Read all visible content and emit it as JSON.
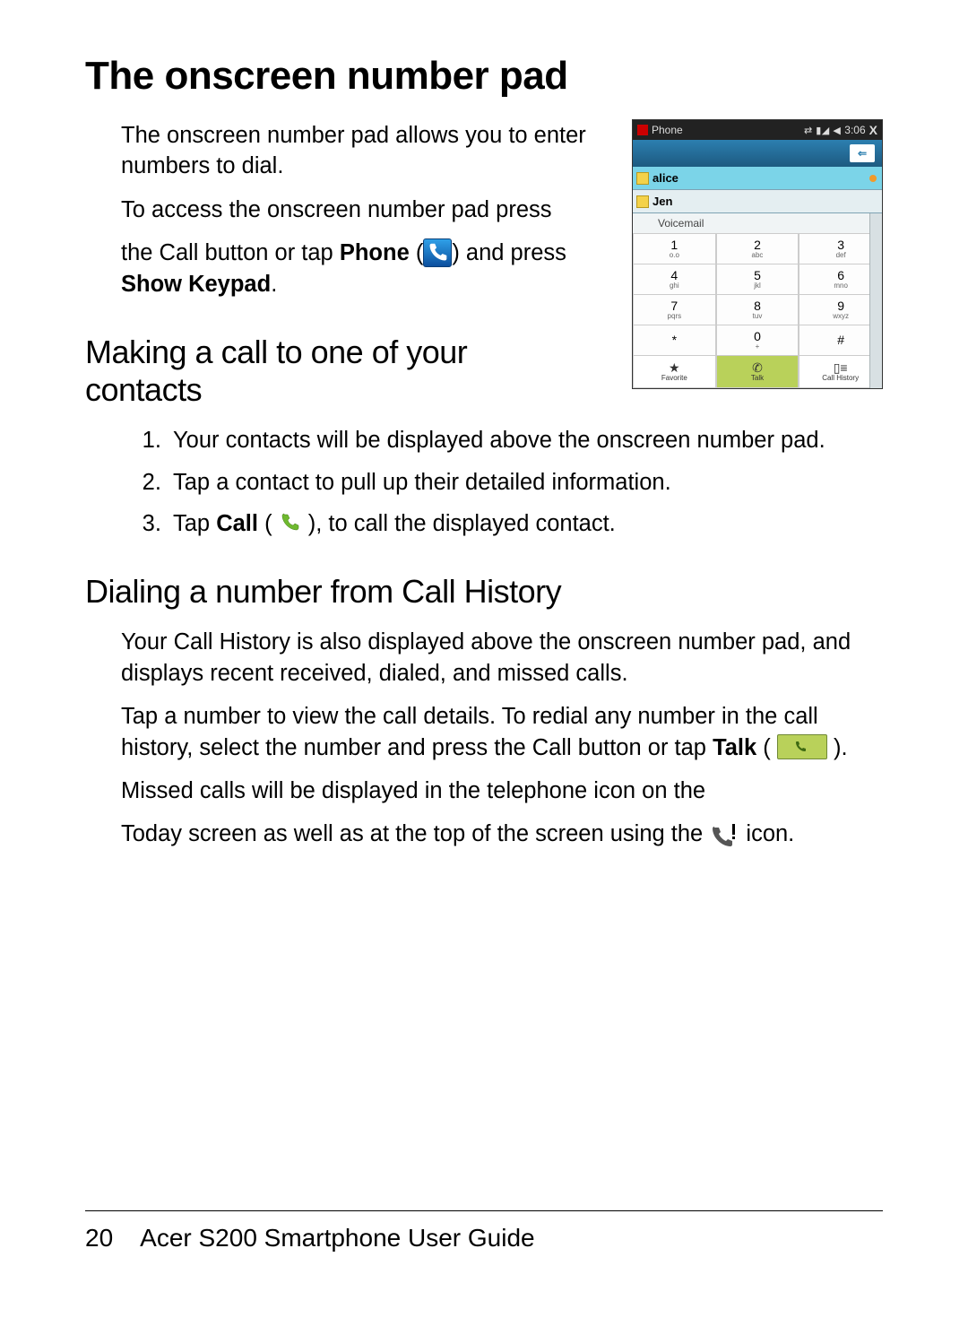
{
  "page": {
    "number": "20",
    "guide_title": "Acer S200 Smartphone User Guide"
  },
  "headings": {
    "h1": "The onscreen number pad",
    "h2_contacts": "Making a call to one of your contacts",
    "h2_history": "Dialing a number from Call History"
  },
  "paras": {
    "intro": "The onscreen number pad allows you to enter numbers to dial.",
    "access": "To access the onscreen number pad press",
    "call_button_prefix": "the Call button or tap ",
    "phone_label": "Phone",
    "open_paren": " (",
    "close_paren_and": ") and press ",
    "show_keypad": "Show Keypad",
    "period": ".",
    "history_p1": "Your Call History is also displayed above the onscreen number pad, and displays recent received, dialed, and missed calls.",
    "history_p2_a": "Tap a number to view the call details. To redial any number in the call history, select the number and press the Call button or tap ",
    "talk_label": "Talk",
    "close_paren_period": ").",
    "missed_a": "Missed calls will be displayed in the telephone icon on the",
    "missed_b_prefix": "Today screen as well as at the top of the screen using the ",
    "missed_b_suffix": " icon."
  },
  "steps": {
    "s1": "Your contacts will be displayed above the onscreen number pad.",
    "s2": "Tap a contact to pull up their detailed information.",
    "s3_prefix": "Tap ",
    "s3_call": "Call",
    "s3_open": " ( ",
    "s3_suffix": " ), to call the displayed contact."
  },
  "phone_mock": {
    "title": "Phone",
    "time": "3:06",
    "close": "X",
    "contacts": [
      "alice",
      "Jen"
    ],
    "voicemail": "Voicemail",
    "keys": [
      {
        "n": "1",
        "l": "o.o"
      },
      {
        "n": "2",
        "l": "abc"
      },
      {
        "n": "3",
        "l": "def"
      },
      {
        "n": "4",
        "l": "ghi"
      },
      {
        "n": "5",
        "l": "jkl"
      },
      {
        "n": "6",
        "l": "mno"
      },
      {
        "n": "7",
        "l": "pqrs"
      },
      {
        "n": "8",
        "l": "tuv"
      },
      {
        "n": "9",
        "l": "wxyz"
      },
      {
        "n": "*",
        "l": ""
      },
      {
        "n": "0",
        "l": "+"
      },
      {
        "n": "#",
        "l": ""
      }
    ],
    "bottom": {
      "fav": "Favorite",
      "talk": "Talk",
      "hist": "Call History"
    }
  }
}
